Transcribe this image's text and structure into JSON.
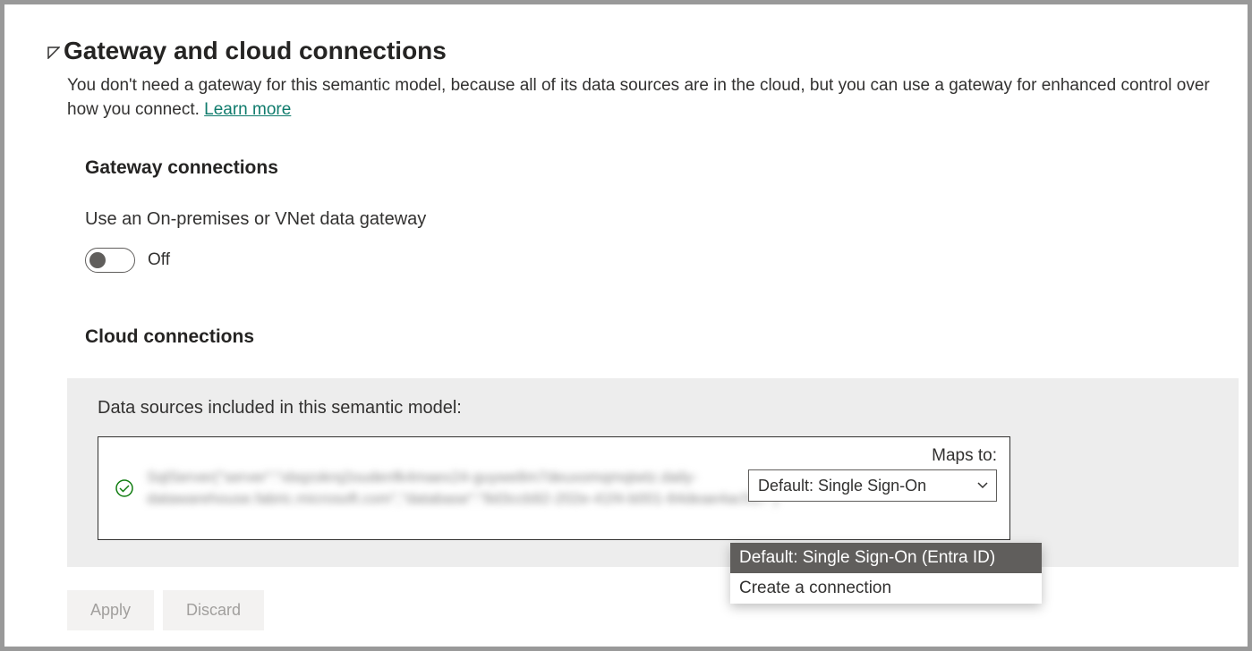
{
  "header": {
    "title": "Gateway and cloud connections",
    "description_pre": "You don't need a gateway for this semantic model, because all of its data sources are in the cloud, but you can use a gateway for enhanced control over how you connect. ",
    "learn_more": "Learn more"
  },
  "gateway": {
    "heading": "Gateway connections",
    "toggle_label": "Use an On-premises or VNet data gateway",
    "toggle_state": "Off"
  },
  "cloud": {
    "heading": "Cloud connections",
    "panel_label": "Data sources included in this semantic model:",
    "blurred_placeholder": "SqlServer(\"server\":\"xbqzokrq2oudenfk4maex24-guywe8m7deuxomqmqiwtz.daily-datawarehouse.fabric.microsoft.com\",\"database\":\"8d3ccb92-202e-41f4-b001-84deae4ac517\")",
    "maps_to_label": "Maps to:",
    "dropdown_selected": "Default: Single Sign-On",
    "options": [
      "Default: Single Sign-On (Entra ID)",
      "Create a connection"
    ]
  },
  "actions": {
    "apply": "Apply",
    "discard": "Discard"
  }
}
